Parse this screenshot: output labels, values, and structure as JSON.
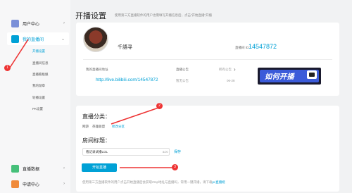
{
  "sidebar": {
    "items": [
      {
        "label": "用户中心",
        "icon": "user-icon",
        "color": "#7a8fd8"
      },
      {
        "label": "我的直播间",
        "icon": "live-room-icon",
        "color": "#00a1d6"
      },
      {
        "label": "直播数据",
        "icon": "data-icon",
        "color": "#46c07a"
      },
      {
        "label": "申请中心",
        "icon": "apply-icon",
        "color": "#f08a3a"
      }
    ],
    "sub_items": [
      {
        "label": "开播设置",
        "active": true
      },
      {
        "label": "直播间信息",
        "active": false
      },
      {
        "label": "直播看板娘",
        "active": false
      },
      {
        "label": "我的勋章",
        "active": false
      },
      {
        "label": "轮播设置",
        "active": false
      },
      {
        "label": "PK设置",
        "active": false
      }
    ]
  },
  "header": {
    "title": "开播设置",
    "subtitle": "使用第三方直播软件的用户也需填写开播信息后，点击“开始直播”开播"
  },
  "profile": {
    "username": "千語寻",
    "room_id_label": "直播间 ID：",
    "room_id": "14547872"
  },
  "address": {
    "label": "我的直播间地址",
    "url": "http://live.bilibili.com/14547872"
  },
  "notice": {
    "label": "直播公告",
    "text": "暂无公告",
    "all_label": "所有公告",
    "date": "06-28"
  },
  "banner": {
    "text": "如何开播"
  },
  "category": {
    "title": "直播分类：",
    "current": "网游",
    "sub": "英雄联盟",
    "more": "修改分区"
  },
  "room_title": {
    "label": "房间标题：",
    "value": "看记录试播LOL",
    "count": "8/20",
    "save": "保存"
  },
  "start_button": {
    "label": "开始直播"
  },
  "footer": {
    "text": "使用第三方直播软件的用户点击开始直播后会获取rtmp地址与直播码，常用一键开播，请下载",
    "link": "pc直播姬"
  },
  "annotations": [
    {
      "number": "1"
    },
    {
      "number": "2"
    },
    {
      "number": "3"
    }
  ],
  "colors": {
    "accent": "#00a1d6",
    "annotation": "#e33333"
  }
}
